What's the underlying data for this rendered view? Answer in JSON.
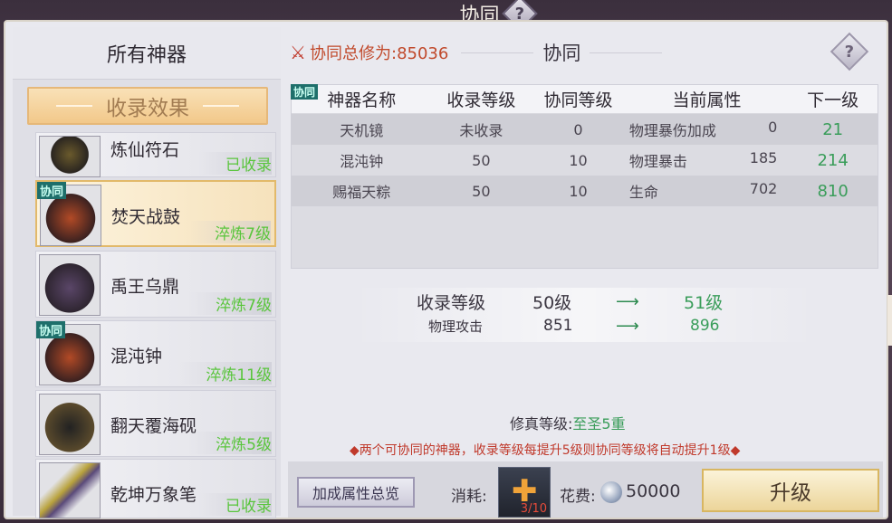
{
  "window": {
    "title": "协同",
    "help": "?"
  },
  "left_panel": {
    "header": "所有神器",
    "collection_button": "收录效果",
    "items": [
      {
        "name": "炼仙符石",
        "status": "已收录",
        "tag": ""
      },
      {
        "name": "焚天战鼓",
        "status": "淬炼7级",
        "tag": "协同",
        "selected": true
      },
      {
        "name": "禹王乌鼎",
        "status": "淬炼7级",
        "tag": ""
      },
      {
        "name": "混沌钟",
        "status": "淬炼11级",
        "tag": "协同"
      },
      {
        "name": "翻天覆海砚",
        "status": "淬炼5级",
        "tag": ""
      },
      {
        "name": "乾坤万象笔",
        "status": "已收录",
        "tag": ""
      }
    ]
  },
  "summary": {
    "total_label": "协同总修为:85036",
    "syn_label": "协同",
    "help": "?"
  },
  "table": {
    "tag": "协同",
    "headers": [
      "神器名称",
      "收录等级",
      "协同等级",
      "当前属性",
      "下一级"
    ],
    "rows": [
      {
        "name": "天机镜",
        "collect": "未收录",
        "syn": "0",
        "attr": "物理暴伤加成",
        "attr_val": "0",
        "next": "21"
      },
      {
        "name": "混沌钟",
        "collect": "50",
        "syn": "10",
        "attr": "物理暴击",
        "attr_val": "185",
        "next": "214"
      },
      {
        "name": "赐福天粽",
        "collect": "50",
        "syn": "10",
        "attr": "生命",
        "attr_val": "702",
        "next": "810"
      }
    ]
  },
  "upgrade": {
    "level_label": "收录等级",
    "level_from": "50级",
    "level_to": "51级",
    "attr_label": "物理攻击",
    "attr_from": "851",
    "attr_to": "896",
    "arrow": "⟶"
  },
  "cultivation": {
    "label": "修真等级:",
    "value": "至圣5重"
  },
  "note": "◆两个可协同的神器，收录等级每提升5级则协同等级将自动提升1级◆",
  "bottom": {
    "overview_button": "加成属性总览",
    "consume_label": "消耗:",
    "consume_count": "3/10",
    "cost_label": "花费:",
    "cost_value": "50000",
    "upgrade_button": "升级"
  }
}
